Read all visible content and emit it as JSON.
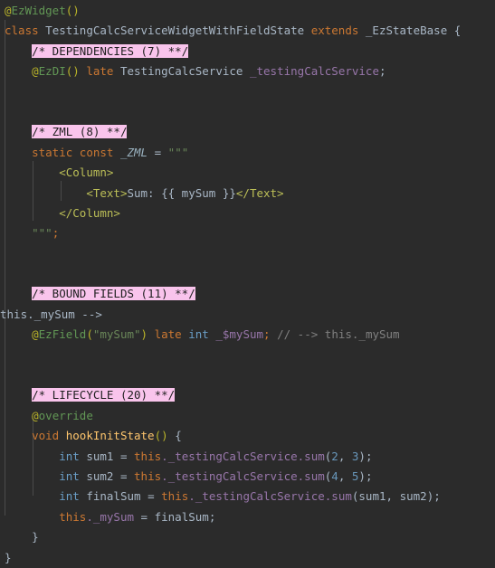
{
  "editor": {
    "language": "dart",
    "theme": "darcula",
    "background_color": "#2b2b2b",
    "default_text_color": "#a9b7c6",
    "section_highlight_color": "#f9c4ec",
    "section_highlight_text_color": "#1f1f1f",
    "indent_guide_color": "#4b4b4b"
  },
  "code": {
    "line1": {
      "at": "@",
      "name": "EzWidget",
      "parens": "()"
    },
    "line2": {
      "class_kw": "class",
      "class_name": "TestingCalcServiceWidgetWithFieldState",
      "extends_kw": "extends",
      "superclass": "_EzStateBase",
      "open_brace": "{"
    },
    "section_dependencies": "/* DEPENDENCIES (7) **/",
    "line_ezdi": {
      "at": "@",
      "name": "EzDI",
      "parens": "()",
      "late_kw": "late",
      "type": "TestingCalcService",
      "field": "_testingCalcService",
      "semicolon": ";"
    },
    "section_zml": "/* ZML (8) **/",
    "line_zml_decl": {
      "static_kw": "static",
      "const_kw": "const",
      "name": "_ZML",
      "equals": "=",
      "quote": "\"\"\""
    },
    "zml_body": {
      "column_open": "<Column>",
      "text_open": "<Text>",
      "text_label": "Sum: ",
      "binding": "{{ mySum }}",
      "text_close": "</Text>",
      "column_close": "</Column>",
      "quote_end": "\"\"\"",
      "semicolon": ";"
    },
    "section_bound_fields": "/* BOUND FIELDS (11) **/",
    "line_ezfield": {
      "at": "@",
      "name": "EzField",
      "open_paren": "(",
      "arg": "\"mySum\"",
      "close_paren": ")",
      "late_kw": "late",
      "type": "int",
      "field": "_$mySum",
      "semicolon": ";",
      "comment": "// --> this._mySum"
    },
    "section_lifecycle": "/* LIFECYCLE (20) **/",
    "line_override": {
      "at": "@",
      "name": "override"
    },
    "line_hook_signature": {
      "return_type": "void",
      "method": "hookInitState",
      "parens": "()",
      "open_brace": "{"
    },
    "line_sum1": {
      "type": "int",
      "var": "sum1",
      "equals": "=",
      "this_kw": "this",
      "receiver": "._testingCalcService",
      "method": ".sum",
      "open_paren": "(",
      "arg1": "2",
      "comma": ", ",
      "arg2": "3",
      "close_paren": ")",
      "semicolon": ";"
    },
    "line_sum2": {
      "type": "int",
      "var": "sum2",
      "equals": "=",
      "this_kw": "this",
      "receiver": "._testingCalcService",
      "method": ".sum",
      "open_paren": "(",
      "arg1": "4",
      "comma": ", ",
      "arg2": "5",
      "close_paren": ")",
      "semicolon": ";"
    },
    "line_final_sum": {
      "type": "int",
      "var": "finalSum",
      "equals": "=",
      "this_kw": "this",
      "receiver": "._testingCalcService",
      "method": ".sum",
      "open_paren": "(",
      "arg1": "sum1",
      "comma": ", ",
      "arg2": "sum2",
      "close_paren": ")",
      "semicolon": ";"
    },
    "line_assign": {
      "this_kw": "this",
      "field": "._mySum",
      "equals": "=",
      "value": "finalSum",
      "semicolon": ";"
    },
    "close_method_brace": "}",
    "close_class_brace": "}"
  }
}
